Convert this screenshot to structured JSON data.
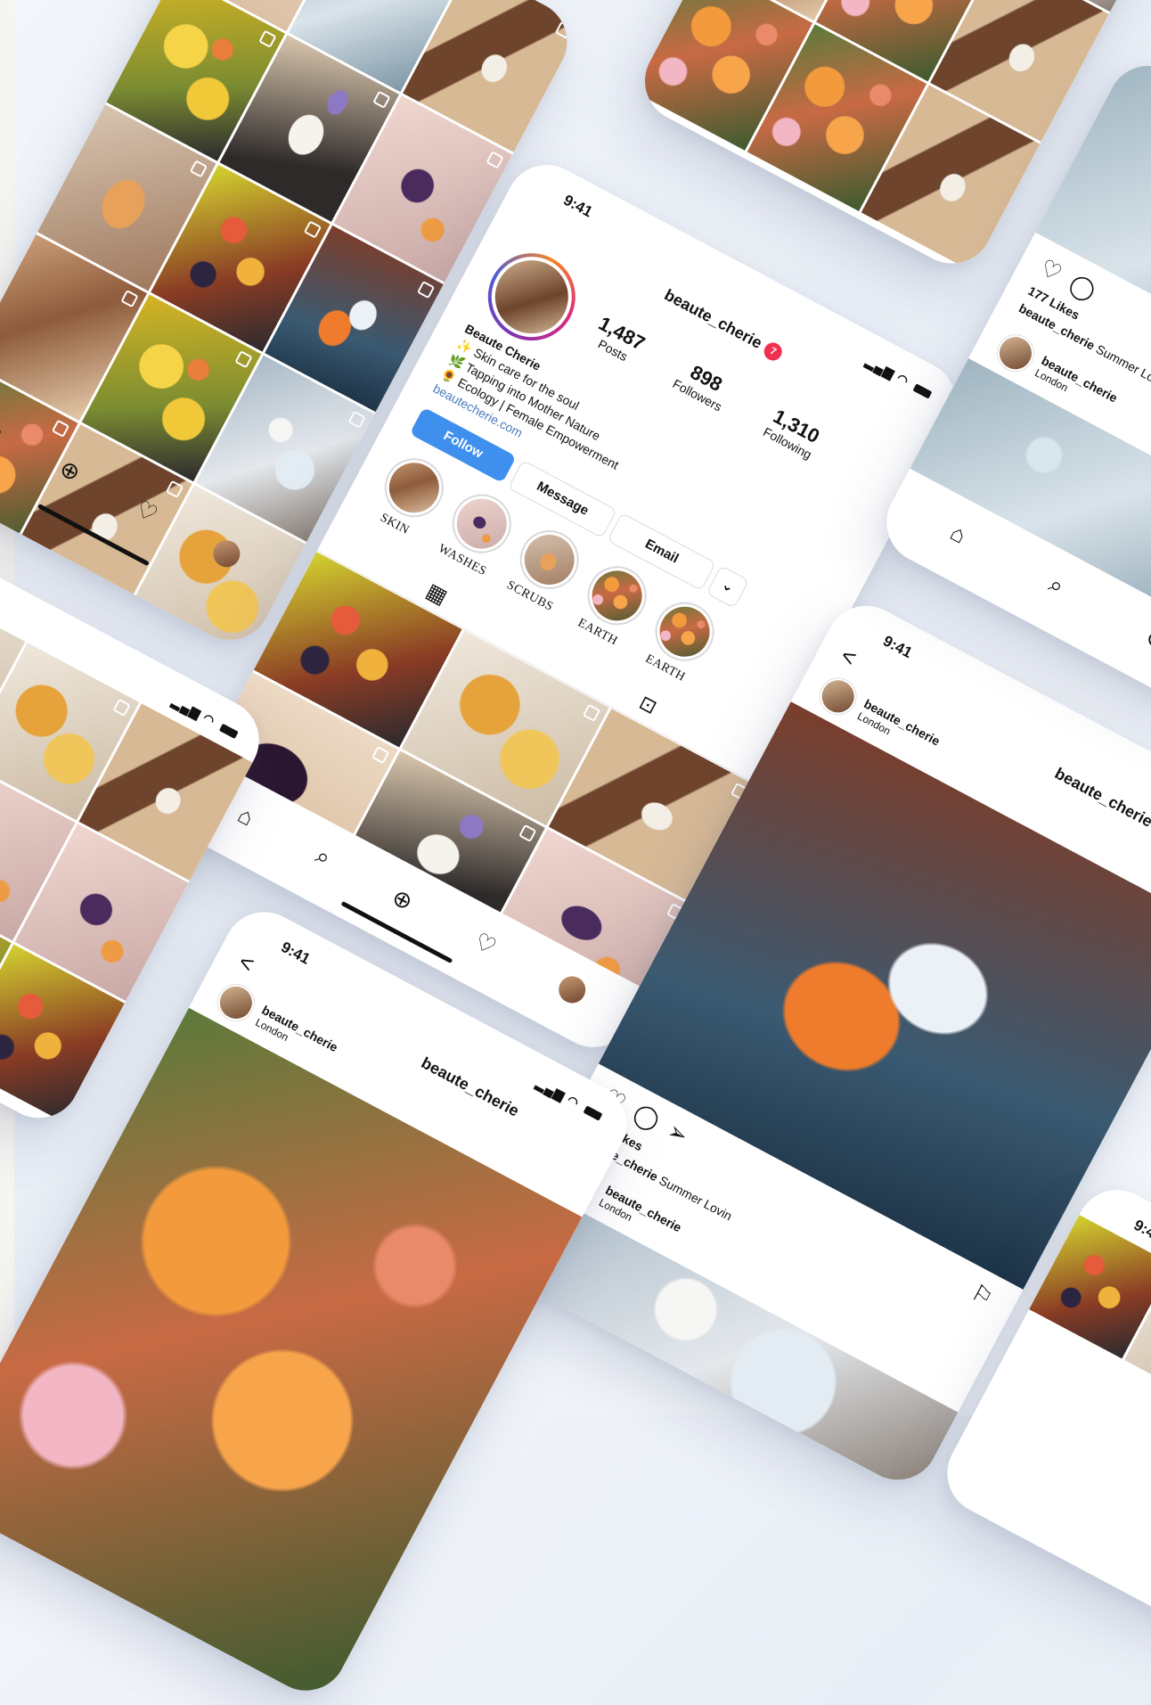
{
  "status": {
    "time": "9:41"
  },
  "profile": {
    "username": "beaute_cherie",
    "notifications": "7",
    "stats": [
      {
        "value": "1,487",
        "label": "Posts"
      },
      {
        "value": "898",
        "label": "Followers"
      },
      {
        "value": "1,310",
        "label": "Following"
      }
    ],
    "bio": {
      "name": "Beaute Cherie",
      "line1": "✨ Skin care for the soul",
      "line2": "🌿 Tapping into Mother Nature",
      "line3": "🌻 Ecology | Female Empowerment",
      "link": "beautecherie.com"
    },
    "buttons": {
      "follow": "Follow",
      "message": "Message",
      "email": "Email",
      "more": "⌄"
    },
    "highlights": [
      "SKIN",
      "WASHES",
      "SCRUBS",
      "EARTH",
      "EARTH"
    ]
  },
  "post": {
    "username": "beaute_cherie",
    "location": "London",
    "title": "beaute_cherie",
    "likes": "177 Likes",
    "caption_user": "beaute_cherie",
    "caption_text": "Summer Lovin",
    "back": "<"
  },
  "icons": {
    "home": "home-icon",
    "search": "search-icon",
    "add": "add-icon",
    "heart": "heart-icon",
    "grid": "grid-icon",
    "tagged": "tagged-icon",
    "comment": "comment-icon",
    "share": "share-icon",
    "bookmark": "bookmark-icon"
  }
}
